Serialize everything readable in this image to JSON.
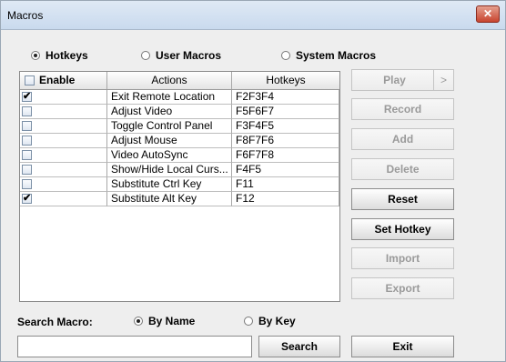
{
  "window": {
    "title": "Macros",
    "close_glyph": "✕"
  },
  "modes": [
    {
      "label": "Hotkeys",
      "selected": true
    },
    {
      "label": "User Macros",
      "selected": false
    },
    {
      "label": "System Macros",
      "selected": false
    }
  ],
  "table": {
    "headers": {
      "enable": "Enable",
      "actions": "Actions",
      "hotkeys": "Hotkeys"
    },
    "rows": [
      {
        "enabled": true,
        "action": "Exit Remote Location",
        "hotkey": "F2F3F4"
      },
      {
        "enabled": false,
        "action": "Adjust Video",
        "hotkey": "F5F6F7"
      },
      {
        "enabled": false,
        "action": "Toggle Control Panel",
        "hotkey": "F3F4F5"
      },
      {
        "enabled": false,
        "action": "Adjust Mouse",
        "hotkey": "F8F7F6"
      },
      {
        "enabled": false,
        "action": "Video AutoSync",
        "hotkey": "F6F7F8"
      },
      {
        "enabled": false,
        "action": "Show/Hide Local Curs...",
        "hotkey": "F4F5"
      },
      {
        "enabled": false,
        "action": "Substitute Ctrl Key",
        "hotkey": "F11"
      },
      {
        "enabled": true,
        "action": "Substitute Alt Key",
        "hotkey": "F12"
      }
    ]
  },
  "buttons": {
    "play": "Play",
    "play_more": ">",
    "record": "Record",
    "add": "Add",
    "delete": "Delete",
    "reset": "Reset",
    "set_hotkey": "Set Hotkey",
    "import": "Import",
    "export": "Export",
    "search": "Search",
    "exit": "Exit"
  },
  "search": {
    "label": "Search Macro:",
    "by_name": "By Name",
    "by_name_selected": true,
    "by_key": "By Key",
    "by_key_selected": false,
    "value": ""
  },
  "checkmark": "✔"
}
